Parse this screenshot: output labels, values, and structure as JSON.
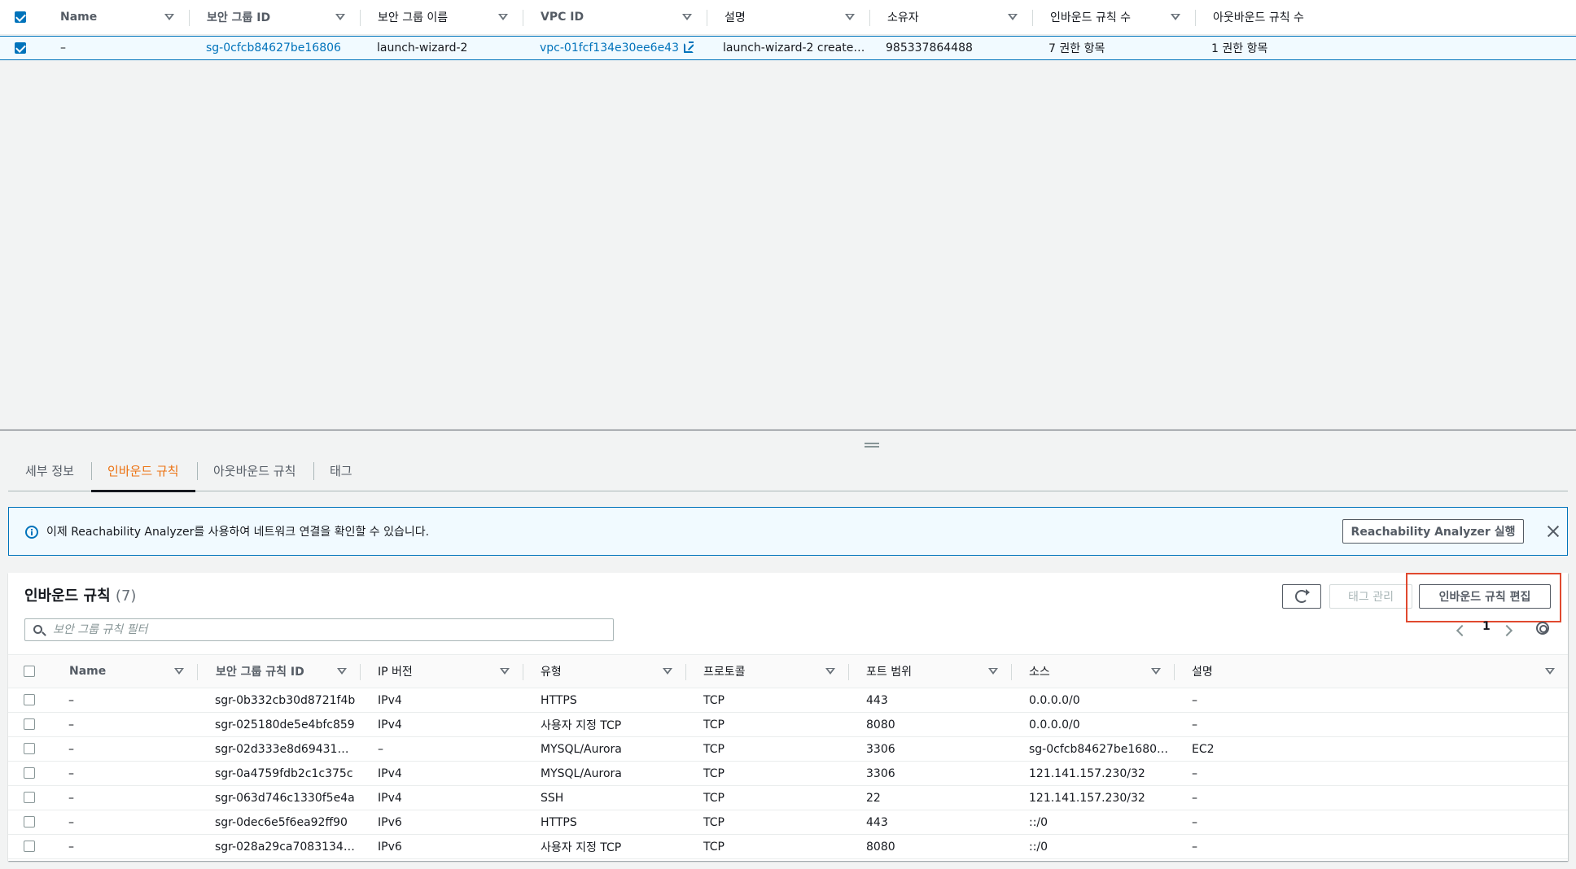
{
  "top_table": {
    "columns": [
      "Name",
      "보안 그룹 ID",
      "보안 그룹 이름",
      "VPC ID",
      "설명",
      "소유자",
      "인바운드 규칙 수",
      "아웃바운드 규칙 수"
    ],
    "row": {
      "name": "–",
      "sg_id": "sg-0cfcb84627be16806",
      "sg_name": "launch-wizard-2",
      "vpc_id": "vpc-01fcf134e30ee6e43",
      "description": "launch-wizard-2 create…",
      "owner": "985337864488",
      "inbound_count": "7 권한 항목",
      "outbound_count": "1 권한 항목"
    }
  },
  "tabs": [
    "세부 정보",
    "인바운드 규칙",
    "아웃바운드 규칙",
    "태그"
  ],
  "active_tab": "인바운드 규칙",
  "banner": {
    "text": "이제 Reachability Analyzer를 사용하여 네트워크 연결을 확인할 수 있습니다.",
    "button": "Reachability Analyzer 실행"
  },
  "rules": {
    "title": "인바운드 규칙",
    "count": "(7)",
    "manage_tags": "태그 관리",
    "edit_button": "인바운드 규칙 편집",
    "search_placeholder": "보안 그룹 규칙 필터",
    "page": "1",
    "columns": [
      "Name",
      "보안 그룹 규칙 ID",
      "IP 버전",
      "유형",
      "프로토콜",
      "포트 범위",
      "소스",
      "설명"
    ],
    "rows": [
      [
        "–",
        "sgr-0b332cb30d8721f4b",
        "IPv4",
        "HTTPS",
        "TCP",
        "443",
        "0.0.0.0/0",
        "–"
      ],
      [
        "–",
        "sgr-025180de5e4bfc859",
        "IPv4",
        "사용자 지정 TCP",
        "TCP",
        "8080",
        "0.0.0.0/0",
        "–"
      ],
      [
        "–",
        "sgr-02d333e8d69431…",
        "–",
        "MYSQL/Aurora",
        "TCP",
        "3306",
        "sg-0cfcb84627be1680…",
        "EC2"
      ],
      [
        "–",
        "sgr-0a4759fdb2c1c375c",
        "IPv4",
        "MYSQL/Aurora",
        "TCP",
        "3306",
        "121.141.157.230/32",
        "–"
      ],
      [
        "–",
        "sgr-063d746c1330f5e4a",
        "IPv4",
        "SSH",
        "TCP",
        "22",
        "121.141.157.230/32",
        "–"
      ],
      [
        "–",
        "sgr-0dec6e5f6ea92ff90",
        "IPv6",
        "HTTPS",
        "TCP",
        "443",
        "::/0",
        "–"
      ],
      [
        "–",
        "sgr-028a29ca7083134…",
        "IPv6",
        "사용자 지정 TCP",
        "TCP",
        "8080",
        "::/0",
        "–"
      ]
    ]
  },
  "colors": {
    "accent_orange": "#ec7211",
    "link_blue": "#0073bb",
    "highlight_red": "#e0492f"
  }
}
